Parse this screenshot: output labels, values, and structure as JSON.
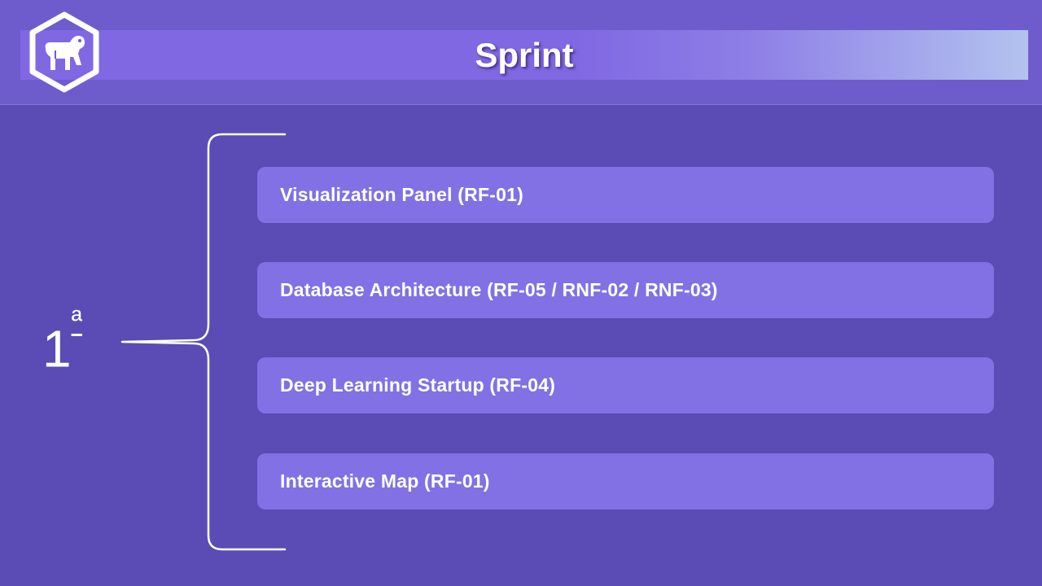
{
  "header": {
    "title": "Sprint",
    "logo_icon": "monkey-hexagon-icon"
  },
  "sprint": {
    "ordinal_number": "1",
    "ordinal_suffix": "ª"
  },
  "items": [
    {
      "label": "Visualization Panel (RF-01)"
    },
    {
      "label": "Database Architecture (RF-05 / RNF-02 / RNF-03)"
    },
    {
      "label": "Deep Learning Startup (RF-04)"
    },
    {
      "label": "Interactive Map (RF-01)"
    }
  ],
  "colors": {
    "background": "#5b4bb4",
    "header": "#6e5ccc",
    "item_box": "#8270e5",
    "text": "#ffffff"
  }
}
